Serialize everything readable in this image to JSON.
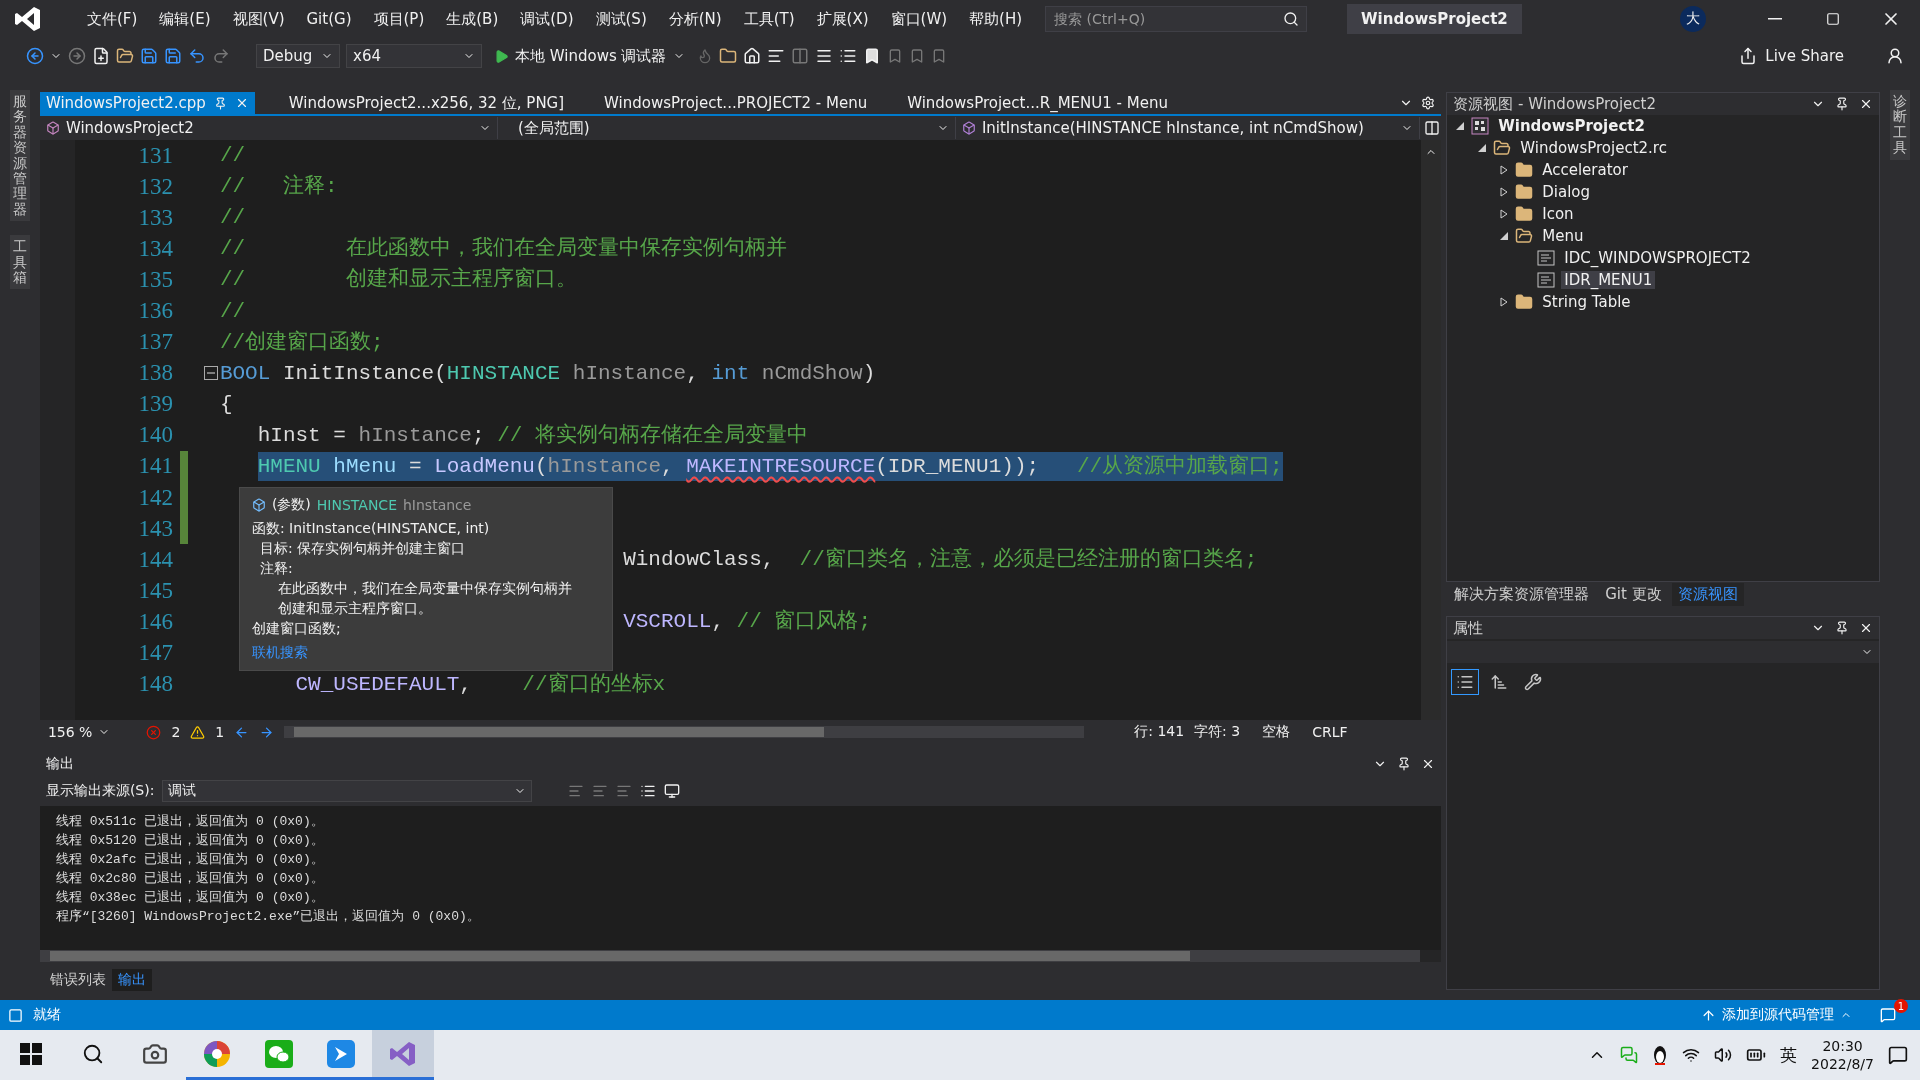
{
  "title_bar": {
    "menu": [
      "文件(F)",
      "编辑(E)",
      "视图(V)",
      "Git(G)",
      "项目(P)",
      "生成(B)",
      "调试(D)",
      "测试(S)",
      "分析(N)",
      "工具(T)",
      "扩展(X)",
      "窗口(W)",
      "帮助(H)"
    ],
    "search": {
      "placeholder": "搜索 (Ctrl+Q)"
    },
    "solution_name": "WindowsProject2",
    "avatar": "大"
  },
  "toolbar": {
    "configuration": "Debug",
    "platform": "x64",
    "debugger": "本地 Windows 调试器",
    "live_share": "Live Share"
  },
  "left_side_tabs": [
    "服务器资源管理器",
    "工具箱"
  ],
  "right_side_tabs": [
    "诊断工具"
  ],
  "document_tabs": [
    {
      "label": "WindowsProject2.cpp",
      "selected": true
    },
    {
      "label": "WindowsProject2...x256, 32 位, PNG]",
      "selected": false
    },
    {
      "label": "WindowsProject...PROJECT2 - Menu",
      "selected": false
    },
    {
      "label": "WindowsProject...R_MENU1 - Menu",
      "selected": false
    }
  ],
  "navigation_bar": {
    "project": "WindowsProject2",
    "scope": "(全局范围)",
    "member": "InitInstance(HINSTANCE hInstance, int nCmdShow)"
  },
  "code_lines": [
    {
      "number": "131",
      "selected": false,
      "changed": false,
      "fold": false,
      "tokens": [
        {
          "kind": "comment",
          "text": "//"
        }
      ]
    },
    {
      "number": "132",
      "selected": false,
      "changed": false,
      "fold": false,
      "tokens": [
        {
          "kind": "comment",
          "text": "//   注释:"
        }
      ]
    },
    {
      "number": "133",
      "selected": false,
      "changed": false,
      "fold": false,
      "tokens": [
        {
          "kind": "comment",
          "text": "//"
        }
      ]
    },
    {
      "number": "134",
      "selected": false,
      "changed": false,
      "fold": false,
      "tokens": [
        {
          "kind": "comment",
          "text": "//        在此函数中，我们在全局变量中保存实例句柄并"
        }
      ]
    },
    {
      "number": "135",
      "selected": false,
      "changed": false,
      "fold": false,
      "tokens": [
        {
          "kind": "comment",
          "text": "//        创建和显示主程序窗口。"
        }
      ]
    },
    {
      "number": "136",
      "selected": false,
      "changed": false,
      "fold": false,
      "tokens": [
        {
          "kind": "comment",
          "text": "//"
        }
      ]
    },
    {
      "number": "137",
      "selected": false,
      "changed": false,
      "fold": false,
      "tokens": [
        {
          "kind": "comment",
          "text": "//创建窗口函数;"
        }
      ]
    },
    {
      "number": "138",
      "selected": false,
      "changed": false,
      "fold": true,
      "tokens": [
        {
          "kind": "keyword",
          "text": "BOOL"
        },
        {
          "kind": "plain",
          "text": " InitInstance("
        },
        {
          "kind": "type",
          "text": "HINSTANCE"
        },
        {
          "kind": "param",
          "text": " hInstance"
        },
        {
          "kind": "plain",
          "text": ", "
        },
        {
          "kind": "keyword",
          "text": "int"
        },
        {
          "kind": "param",
          "text": " nCmdShow"
        },
        {
          "kind": "plain",
          "text": ")"
        }
      ]
    },
    {
      "number": "139",
      "selected": false,
      "changed": false,
      "fold": false,
      "tokens": [
        {
          "kind": "plain",
          "text": "{"
        }
      ]
    },
    {
      "number": "140",
      "selected": false,
      "changed": false,
      "fold": false,
      "tokens": [
        {
          "kind": "plain",
          "text": "   hInst = "
        },
        {
          "kind": "param",
          "text": "hInstance"
        },
        {
          "kind": "plain",
          "text": "; "
        },
        {
          "kind": "comment",
          "text": "// 将实例句柄存储在全局变量中"
        }
      ]
    },
    {
      "number": "141",
      "selected": true,
      "changed": true,
      "fold": false,
      "tokens": [
        {
          "kind": "type",
          "text": "   HMENU"
        },
        {
          "kind": "local",
          "text": " hMenu"
        },
        {
          "kind": "plain",
          "text": " = "
        },
        {
          "kind": "func",
          "text": "LoadMenu"
        },
        {
          "kind": "plain",
          "text": "("
        },
        {
          "kind": "param",
          "text": "hInstance"
        },
        {
          "kind": "plain",
          "text": ", "
        },
        {
          "kind": "macro_error",
          "text": "MAKEINTRESOURCE"
        },
        {
          "kind": "plain",
          "text": "(IDR_MENU1));   "
        },
        {
          "kind": "comment",
          "text": "//从资源中加载窗口;"
        }
      ]
    },
    {
      "number": "142",
      "changed": true,
      "fold": false
    },
    {
      "number": "143",
      "changed": true,
      "fold": false
    },
    {
      "number": "144",
      "selected": false,
      "changed": false,
      "fold": false,
      "tokens": [
        {
          "kind": "plain",
          "text": "                                WindowClass,  "
        },
        {
          "kind": "comment",
          "text": "//窗口类名，注意，必须是已经注册的窗口类名;"
        }
      ]
    },
    {
      "number": "145",
      "changed": false,
      "fold": false
    },
    {
      "number": "146",
      "selected": false,
      "changed": false,
      "fold": false,
      "tokens": [
        {
          "kind": "macro",
          "text": "                                VSCROLL"
        },
        {
          "kind": "plain",
          "text": ", "
        },
        {
          "kind": "comment",
          "text": "// 窗口风格;"
        }
      ]
    },
    {
      "number": "147",
      "changed": false,
      "fold": false
    },
    {
      "number": "148",
      "selected": false,
      "changed": false,
      "fold": false,
      "tokens": [
        {
          "kind": "macro",
          "text": "      CW_USEDEFAULT"
        },
        {
          "kind": "plain",
          "text": ",    "
        },
        {
          "kind": "comment",
          "text": "//窗口的坐标x"
        }
      ]
    }
  ],
  "quick_info": {
    "category": "(参数)",
    "type": "HINSTANCE",
    "name": "hInstance",
    "lines": [
      {
        "kind": "heading",
        "text": "函数: InitInstance(HINSTANCE, int)"
      },
      {
        "kind": "sub",
        "text": "目标: 保存实例句柄并创建主窗口"
      },
      {
        "kind": "sub",
        "text": "注释:"
      },
      {
        "kind": "body",
        "text": "在此函数中，我们在全局变量中保存实例句柄并"
      },
      {
        "kind": "body",
        "text": "创建和显示主程序窗口。"
      },
      {
        "kind": "heading",
        "text": "创建窗口函数;"
      }
    ],
    "link": "联机搜索"
  },
  "editor_status": {
    "zoom": "156 %",
    "errors": "2",
    "warnings": "1",
    "line": "行: 141",
    "column": "字符: 3",
    "whitespace": "空格",
    "line_ending": "CRLF"
  },
  "output": {
    "title": "输出",
    "source_label": "显示输出来源(S):",
    "source": "调试",
    "lines": [
      "线程 0x511c 已退出，返回值为 0 (0x0)。",
      "线程 0x5120 已退出，返回值为 0 (0x0)。",
      "线程 0x2afc 已退出，返回值为 0 (0x0)。",
      "线程 0x2c80 已退出，返回值为 0 (0x0)。",
      "线程 0x38ec 已退出，返回值为 0 (0x0)。",
      "程序“[3260] WindowsProject2.exe”已退出，返回值为 0 (0x0)。"
    ]
  },
  "bottom_tabs": [
    {
      "label": "错误列表",
      "selected": false
    },
    {
      "label": "输出",
      "selected": true
    }
  ],
  "resource_view": {
    "title": "资源视图 - WindowsProject2",
    "tree": [
      {
        "label": "WindowsProject2",
        "kind": "project",
        "expanded": true,
        "selected": false,
        "children": [
          {
            "label": "WindowsProject2.rc",
            "kind": "folder",
            "expanded": true,
            "selected": false,
            "children": [
              {
                "label": "Accelerator",
                "kind": "folder",
                "expanded": false,
                "selected": false
              },
              {
                "label": "Dialog",
                "kind": "folder",
                "expanded": false,
                "selected": false
              },
              {
                "label": "Icon",
                "kind": "folder",
                "expanded": false,
                "selected": false
              },
              {
                "label": "Menu",
                "kind": "folder",
                "expanded": true,
                "selected": false,
                "children": [
                  {
                    "label": "IDC_WINDOWSPROJECT2",
                    "kind": "resource",
                    "selected": false
                  },
                  {
                    "label": "IDR_MENU1",
                    "kind": "resource",
                    "selected": true
                  }
                ]
              },
              {
                "label": "String Table",
                "kind": "folder",
                "expanded": false,
                "selected": false
              }
            ]
          }
        ]
      }
    ]
  },
  "panel_tabs": [
    {
      "label": "解决方案资源管理器",
      "selected": false
    },
    {
      "label": "Git 更改",
      "selected": false
    },
    {
      "label": "资源视图",
      "selected": true
    }
  ],
  "properties": {
    "title": "属性",
    "view_buttons": [
      {
        "kind": "categorized",
        "selected": true
      },
      {
        "kind": "alphabetical",
        "selected": false
      },
      {
        "kind": "pages",
        "selected": false
      }
    ]
  },
  "status_bar": {
    "status": "就绪",
    "source_control": "添加到源代码管理",
    "notifications": "1"
  },
  "taskbar": {
    "apps": [
      {
        "kind": "camera",
        "running": false,
        "selected": false
      },
      {
        "kind": "colorwheel",
        "running": true,
        "selected": false
      },
      {
        "kind": "chat",
        "running": true,
        "selected": false
      },
      {
        "kind": "bird",
        "running": true,
        "selected": false
      },
      {
        "kind": "vs",
        "running": true,
        "selected": true
      }
    ],
    "input_method": "英",
    "time": "20:30",
    "date": "2022/8/7"
  }
}
